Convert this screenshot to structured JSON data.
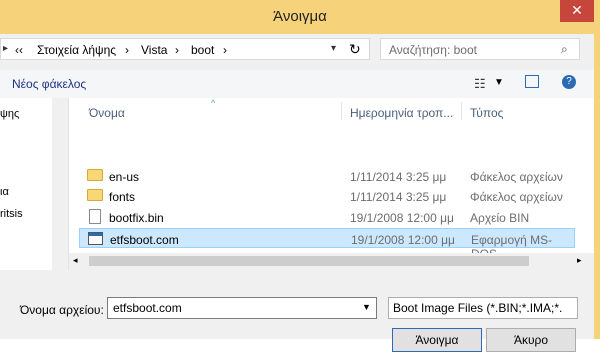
{
  "title": "Άνοιγμα",
  "close_glyph": "✕",
  "address": {
    "back_glyph": "‹‹",
    "segments": [
      "Στοιχεία λήψης",
      "Vista",
      "boot"
    ],
    "sep": "›",
    "search_placeholder": "Αναζήτηση: boot"
  },
  "toolbar": {
    "new_folder": "Νέος φάκελος"
  },
  "nav": {
    "items": [
      "ψης",
      "ια",
      "ritsis"
    ]
  },
  "columns": {
    "name": "Όνομα",
    "date": "Ημερομηνία τροπ...",
    "type": "Τύπος"
  },
  "files": [
    {
      "name": "en-us",
      "date": "1/11/2014 3:25 μμ",
      "type": "Φάκελος αρχείων",
      "icon": "folder-icon"
    },
    {
      "name": "fonts",
      "date": "1/11/2014 3:25 μμ",
      "type": "Φάκελος αρχείων",
      "icon": "folder-icon"
    },
    {
      "name": "bootfix.bin",
      "date": "19/1/2008 12:00 μμ",
      "type": "Αρχείο BIN",
      "icon": "file-icon"
    },
    {
      "name": "etfsboot.com",
      "date": "19/1/2008 12:00 μμ",
      "type": "Εφαρμογή MS-DOS",
      "icon": "app-icon"
    }
  ],
  "selected_index": 3,
  "bottom": {
    "filename_label": "Όνομα αρχείου:",
    "filename_value": "etfsboot.com",
    "filter": "Boot Image Files (*.BIN;*.IMA;*.",
    "open": "Άνοιγμα",
    "cancel": "Άκυρο"
  },
  "colors": {
    "frame": "#f6d27a",
    "close": "#c7463c",
    "selection": "#cce8ff"
  }
}
